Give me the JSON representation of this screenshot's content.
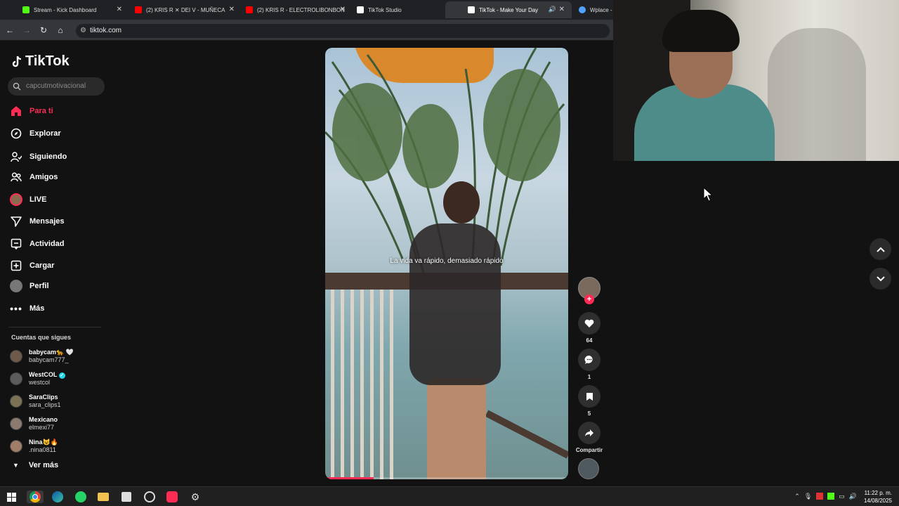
{
  "browser": {
    "tabs": [
      {
        "title": "Stream - Kick Dashboard",
        "color": "#53fc18",
        "active": false
      },
      {
        "title": "(2) KRIS R ✕ DEI V - MUÑECA",
        "color": "#ff0000",
        "active": false
      },
      {
        "title": "(2) KRIS R - ELECTROLIBONBON",
        "color": "#ff0000",
        "active": false
      },
      {
        "title": "TikTok Studio",
        "color": "#ffffff",
        "active": false
      },
      {
        "title": "TikTok - Make Your Day",
        "color": "#ffffff",
        "active": true
      },
      {
        "title": "Wplace -",
        "color": "#4fa3ff",
        "active": false
      }
    ],
    "url": "tiktok.com"
  },
  "tiktok": {
    "brand": "TikTok",
    "search_placeholder": "capcutmotivacional",
    "nav": [
      {
        "label": "Para ti",
        "icon": "home-icon",
        "active": true
      },
      {
        "label": "Explorar",
        "icon": "compass-icon",
        "active": false
      },
      {
        "label": "Siguiendo",
        "icon": "following-icon",
        "active": false
      },
      {
        "label": "Amigos",
        "icon": "friends-icon",
        "active": false
      },
      {
        "label": "LIVE",
        "icon": "live-icon",
        "active": false
      },
      {
        "label": "Mensajes",
        "icon": "messages-icon",
        "active": false
      },
      {
        "label": "Actividad",
        "icon": "activity-icon",
        "active": false
      },
      {
        "label": "Cargar",
        "icon": "upload-icon",
        "active": false
      },
      {
        "label": "Perfil",
        "icon": "profile-icon",
        "active": false
      },
      {
        "label": "Más",
        "icon": "more-icon",
        "active": false
      }
    ],
    "following_title": "Cuentas que sigues",
    "accounts": [
      {
        "name": "babycam🐆 🤍",
        "handle": "babycam777_"
      },
      {
        "name": "WestCOL",
        "handle": "westcol",
        "verified": true
      },
      {
        "name": "SaraClips",
        "handle": "sara_clips1"
      },
      {
        "name": "Mexicano",
        "handle": "elmexi77"
      },
      {
        "name": "Nina😺🔥",
        "handle": ".nina0811"
      }
    ],
    "see_more": "Ver más",
    "video": {
      "caption": "La vida va rápido, demasiado rápido",
      "progress_percent": 20
    },
    "actions": {
      "likes": "64",
      "comments": "1",
      "saves": "5",
      "share_label": "Compartir"
    },
    "accent": "#fe2c55"
  },
  "taskbar": {
    "time": "11:22 p. m.",
    "date": "14/08/2025"
  }
}
